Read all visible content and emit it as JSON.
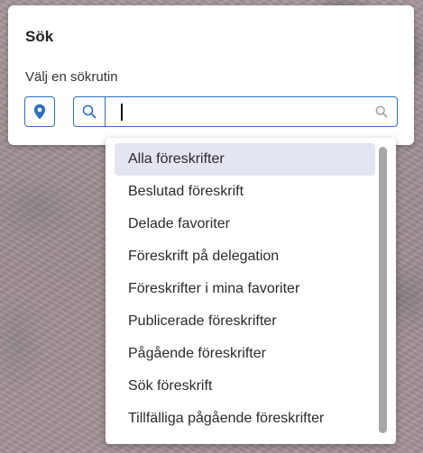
{
  "panel": {
    "title": "Sök",
    "label": "Välj en sökrutin"
  },
  "buttons": {
    "location_icon": "map-pin-icon",
    "search_icon": "search-icon"
  },
  "search": {
    "value": "",
    "placeholder": "",
    "right_icon": "search-icon"
  },
  "dropdown": {
    "highlighted_index": 0,
    "options": [
      "Alla föreskrifter",
      "Beslutad föreskrift",
      "Delade favoriter",
      "Föreskrift på delegation",
      "Föreskrifter i mina favoriter",
      "Publicerade föreskrifter",
      "Pågående föreskrifter",
      "Sök föreskrift",
      "Tillfälliga pågående föreskrifter"
    ]
  },
  "colors": {
    "accent": "#2f6fba",
    "highlight": "#e3e5f1",
    "scrollbar": "#a7a7a7"
  }
}
